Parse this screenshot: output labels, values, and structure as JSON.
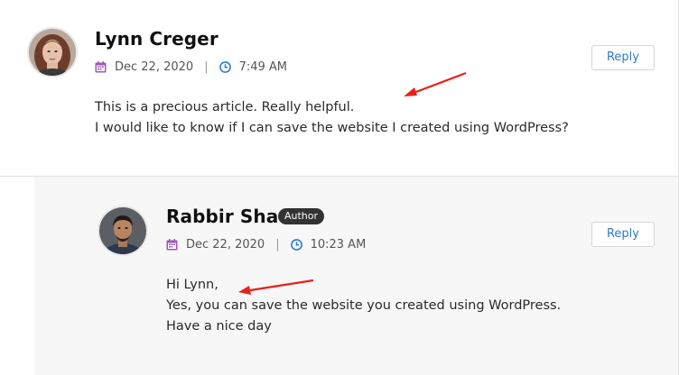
{
  "comments": [
    {
      "author": "Lynn Creger",
      "date": "Dec 22, 2020",
      "time": "7:49 AM",
      "lines": [
        "This is a precious article. Really helpful.",
        "I would like to know if I can save the website I created using WordPress?"
      ],
      "reply_label": "Reply"
    },
    {
      "author": "Rabbir Shad",
      "badge": "Author",
      "date": "Dec 22, 2020",
      "time": "10:23 AM",
      "lines": [
        "Hi Lynn,",
        "Yes, you can save the website you created using WordPress.",
        "Have a nice day"
      ],
      "reply_label": "Reply"
    }
  ],
  "colors": {
    "calendar_icon": "#9b59b6",
    "clock_icon": "#2f7bd6",
    "reply_text": "#2f7bbf",
    "annotation_arrow": "#e8201a",
    "badge_bg": "#333333"
  }
}
